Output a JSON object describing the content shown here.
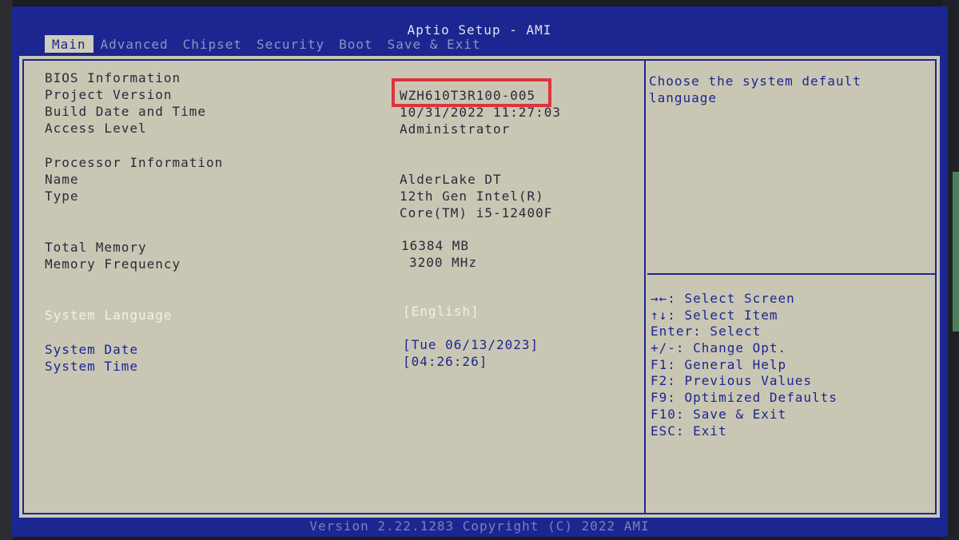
{
  "app_title": "Aptio Setup - AMI",
  "tabs": [
    {
      "label": "Main"
    },
    {
      "label": "Advanced"
    },
    {
      "label": "Chipset"
    },
    {
      "label": "Security"
    },
    {
      "label": "Boot"
    },
    {
      "label": "Save & Exit"
    }
  ],
  "active_tab": "Main",
  "bios": {
    "section": "BIOS Information",
    "project_version_label": "Project Version",
    "project_version": "WZH610T3R100-005",
    "build_date_label": "Build Date and Time",
    "build_date": "10/31/2022 11:27:03",
    "access_level_label": "Access Level",
    "access_level": "Administrator"
  },
  "processor": {
    "section": "Processor Information",
    "name_label": "Name",
    "name": "AlderLake DT",
    "type_label": "Type",
    "type_line1": "12th Gen Intel(R)",
    "type_line2": "Core(TM) i5-12400F"
  },
  "memory": {
    "total_label": "Total Memory",
    "total": "16384 MB",
    "freq_label": "Memory Frequency",
    "freq": "3200 MHz"
  },
  "settings": {
    "language_label": "System Language",
    "language": "[English]",
    "date_label": "System Date",
    "date": "[Tue 06/13/2023]",
    "time_label": "System Time",
    "time": "[04:26:26]"
  },
  "help_text": [
    "Choose the system default",
    "language"
  ],
  "key_help": [
    "→←: Select Screen",
    "↑↓: Select Item",
    "Enter: Select",
    "+/-: Change Opt.",
    "F1: General Help",
    "F2: Previous Values",
    "F9: Optimized Defaults",
    "F10: Save & Exit",
    "ESC: Exit"
  ],
  "footer": "Version 2.22.1283 Copyright (C) 2022 AMI",
  "colors": {
    "screen_blue": "#1c2690",
    "panel_bg": "#c9c7b4",
    "highlight_red": "#e0323d",
    "selected_text": "#f1f0e6"
  }
}
